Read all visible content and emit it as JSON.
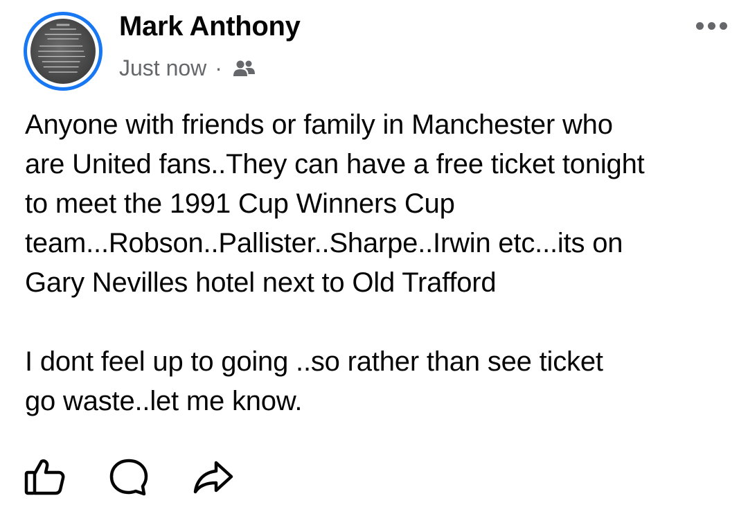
{
  "author": {
    "name": "Mark Anthony",
    "avatar_icon": "profile-photo-sign-icon"
  },
  "meta": {
    "time": "Just now",
    "separator": "·",
    "audience_icon": "friends-icon"
  },
  "post": {
    "lines_p1": [
      "Anyone with friends or family in Manchester who",
      "are United fans..They can have a free ticket tonight",
      "to meet the 1991 Cup Winners Cup",
      "team...Robson..Pallister..Sharpe..Irwin etc...its on",
      "Gary Nevilles hotel next to Old Trafford"
    ],
    "lines_p2": [
      "I dont feel up to going ..so rather than see ticket",
      "go waste..let me know."
    ]
  },
  "actions": {
    "like_icon": "thumbs-up-icon",
    "comment_icon": "comment-icon",
    "share_icon": "share-icon"
  },
  "menu": {
    "more_icon": "more-dots-icon"
  },
  "colors": {
    "accent": "#1877f2",
    "text": "#050505",
    "secondary": "#65676b"
  }
}
